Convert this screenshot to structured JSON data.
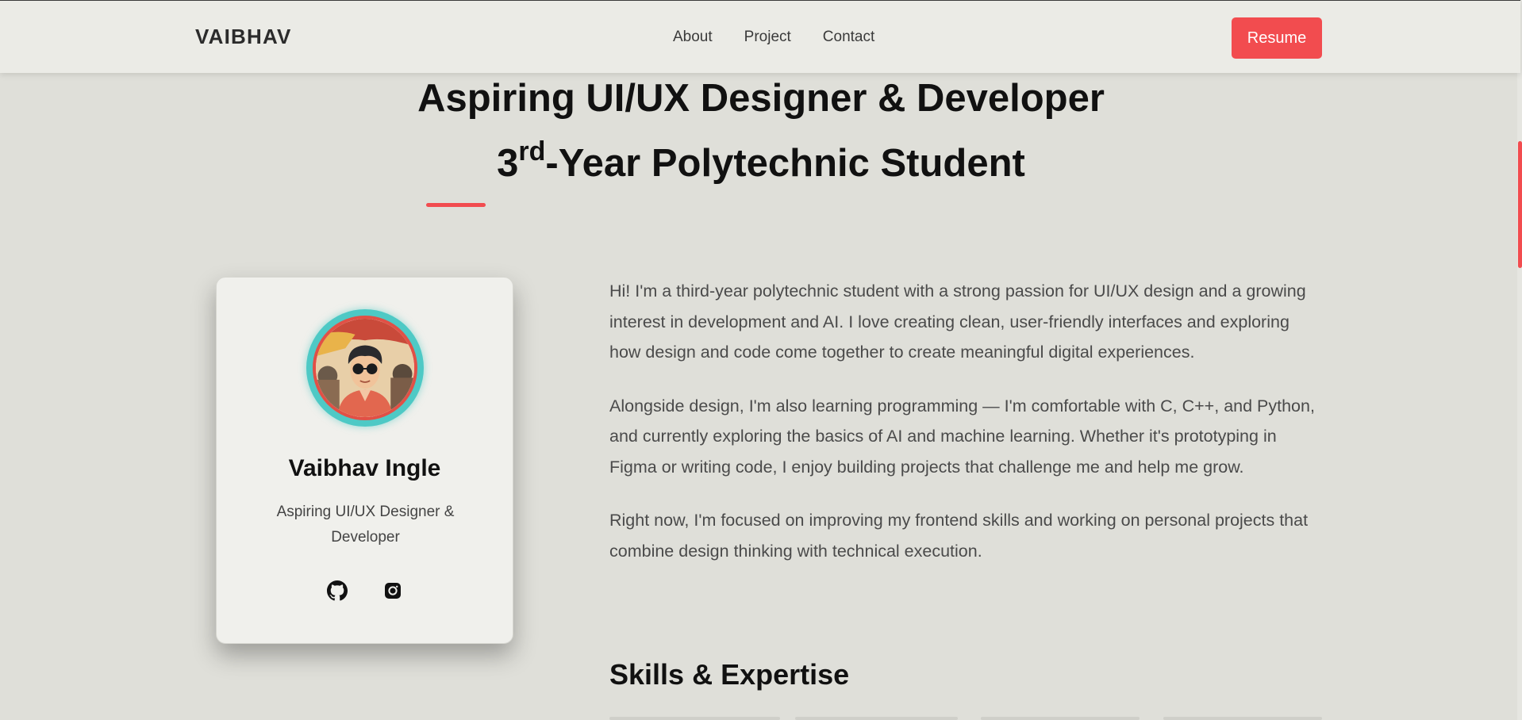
{
  "nav": {
    "logo": "VAIBHAV",
    "links": [
      "About",
      "Project",
      "Contact"
    ],
    "resume_label": "Resume"
  },
  "hero": {
    "title": "Aspiring UI/UX Designer & Developer",
    "subtitle_number": "3",
    "subtitle_sup": "rd",
    "subtitle_rest": "-Year Polytechnic Student"
  },
  "card": {
    "name": "Vaibhav Ingle",
    "role": "Aspiring UI/UX Designer & Developer",
    "socials": [
      "github-icon",
      "instagram-icon"
    ]
  },
  "about": {
    "paragraphs": [
      "Hi! I'm a third-year polytechnic student with a strong passion for UI/UX design and a growing interest in development and AI. I love creating clean, user-friendly interfaces and exploring how design and code come together to create meaningful digital experiences.",
      "Alongside design, I'm also learning programming — I'm comfortable with C, C++, and Python, and currently exploring the basics of AI and machine learning. Whether it's prototyping in Figma or writing code, I enjoy building projects that challenge me and help me grow.",
      "Right now, I'm focused on improving my frontend skills and working on personal projects that combine design thinking with technical execution."
    ]
  },
  "skills": {
    "heading": "Skills & Expertise"
  },
  "colors": {
    "accent": "#f24c4f",
    "background": "#dfdfd9",
    "navbar": "#ebebe6",
    "card": "#f0f0ec",
    "avatar_ring": "#4ec9c5"
  }
}
